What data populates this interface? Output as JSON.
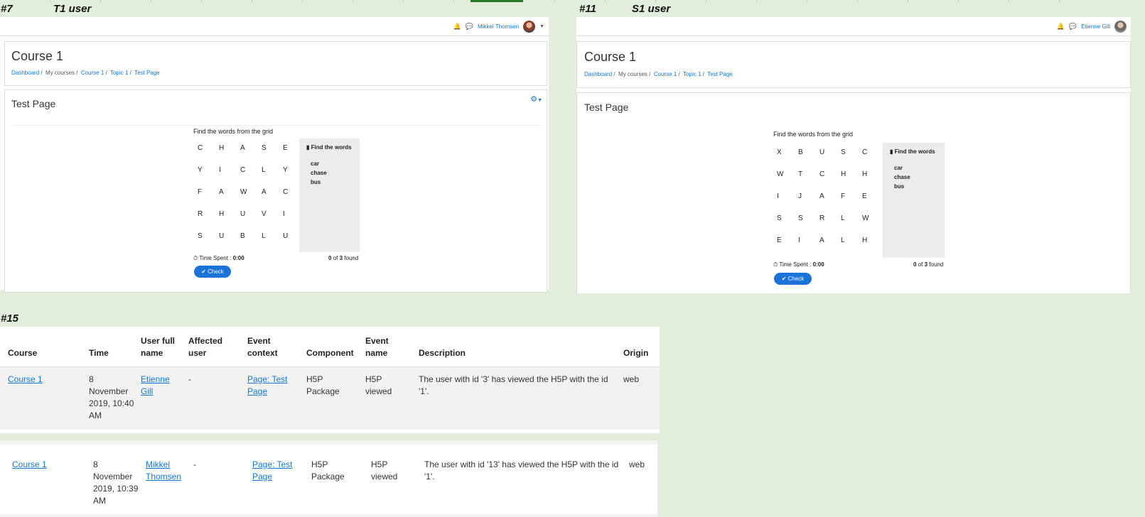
{
  "tags": {
    "left": {
      "num": "#7",
      "role": "T1 user"
    },
    "right": {
      "num": "#11",
      "role": "S1 user"
    },
    "log": {
      "num": "#15"
    }
  },
  "left": {
    "user_name": "Mikkel Thomsen",
    "course_title": "Course 1",
    "breadcrumb": [
      "Dashboard",
      "My courses",
      "Course 1",
      "Topic 1",
      "Test Page"
    ],
    "page_title": "Test Page",
    "game": {
      "question": "Find the words from the grid",
      "grid": [
        [
          "C",
          "H",
          "A",
          "S",
          "E"
        ],
        [
          "Y",
          "I",
          "C",
          "L",
          "Y"
        ],
        [
          "F",
          "A",
          "W",
          "A",
          "C"
        ],
        [
          "R",
          "H",
          "U",
          "V",
          "I"
        ],
        [
          "S",
          "U",
          "B",
          "L",
          "U"
        ]
      ],
      "words_header": "Find the words",
      "words": [
        "car",
        "chase",
        "bus"
      ],
      "time_label": "Time Spent :",
      "time_value": "0:00",
      "found_count": "0",
      "found_of": "of",
      "found_total": "3",
      "found_suffix": "found",
      "check_label": "Check"
    }
  },
  "right": {
    "user_name": "Etienne Gill",
    "course_title": "Course 1",
    "breadcrumb": [
      "Dashboard",
      "My courses",
      "Course 1",
      "Topic 1",
      "Test Page"
    ],
    "page_title": "Test Page",
    "game": {
      "question": "Find the words from the grid",
      "grid": [
        [
          "X",
          "B",
          "U",
          "S",
          "C"
        ],
        [
          "W",
          "T",
          "C",
          "H",
          "H"
        ],
        [
          "I",
          "J",
          "A",
          "F",
          "E"
        ],
        [
          "S",
          "S",
          "R",
          "L",
          "W"
        ],
        [
          "E",
          "I",
          "A",
          "L",
          "H"
        ]
      ],
      "words_header": "Find the words",
      "words": [
        "car",
        "chase",
        "bus"
      ],
      "time_label": "Time Spent :",
      "time_value": "0:00",
      "found_count": "0",
      "found_of": "of",
      "found_total": "3",
      "found_suffix": "found",
      "check_label": "Check"
    }
  },
  "log": {
    "headers": [
      "Course",
      "Time",
      "User full name",
      "Affected user",
      "Event context",
      "Component",
      "Event name",
      "Description",
      "Origin"
    ],
    "rows": [
      {
        "course": "Course 1",
        "time": "8 November 2019, 10:40 AM",
        "user": "Etienne Gill",
        "affected": "-",
        "context": "Page: Test Page",
        "component": "H5P Package",
        "event": "H5P viewed",
        "description": "The user with id '3' has viewed the H5P with the id '1'.",
        "origin": "web"
      },
      {
        "course": "Course 1",
        "time": "8 November 2019, 10:39 AM",
        "user": "Mikkel Thomsen",
        "affected": "-",
        "context": "Page: Test Page",
        "component": "H5P Package",
        "event": "H5P viewed",
        "description": "The user with id '13' has viewed the H5P with the id '1'.",
        "origin": "web"
      }
    ]
  }
}
